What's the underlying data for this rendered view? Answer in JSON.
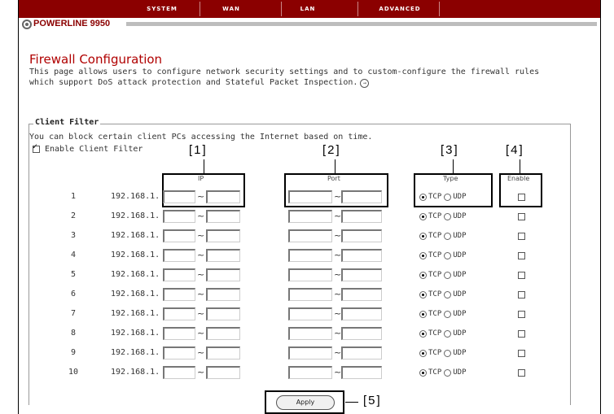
{
  "nav": {
    "items": [
      "SYSTEM",
      "WAN",
      "LAN",
      "ADVANCED"
    ]
  },
  "brand": {
    "name": "POWERLINE 9950"
  },
  "page": {
    "title": "Firewall Configuration",
    "description": "This page allows users to configure network security settings and to custom-configure the firewall rules which support DoS attack protection and Stateful Packet Inspection."
  },
  "client_filter": {
    "legend": "Client Filter",
    "description": "You can block certain client PCs accessing the Internet based on time.",
    "enable_label": "Enable Client Filter",
    "enable_checked": true,
    "callouts": [
      "[1]",
      "[2]",
      "[3]",
      "[4]",
      "[5]"
    ],
    "headers": {
      "ip": "IP",
      "port": "Port",
      "type": "Type",
      "enable": "Enable"
    },
    "ip_prefix": "192.168.1.",
    "type_options": [
      "TCP",
      "UDP"
    ],
    "rows": [
      {
        "num": "1",
        "type": "TCP",
        "enabled": false
      },
      {
        "num": "2",
        "type": "TCP",
        "enabled": false
      },
      {
        "num": "3",
        "type": "TCP",
        "enabled": false
      },
      {
        "num": "4",
        "type": "TCP",
        "enabled": false
      },
      {
        "num": "5",
        "type": "TCP",
        "enabled": false
      },
      {
        "num": "6",
        "type": "TCP",
        "enabled": false
      },
      {
        "num": "7",
        "type": "TCP",
        "enabled": false
      },
      {
        "num": "8",
        "type": "TCP",
        "enabled": false
      },
      {
        "num": "9",
        "type": "TCP",
        "enabled": false
      },
      {
        "num": "10",
        "type": "TCP",
        "enabled": false
      }
    ],
    "apply_label": "Apply"
  },
  "colors": {
    "nav_bg": "#8b0000",
    "title": "#b00000",
    "brand": "#8b0000"
  }
}
